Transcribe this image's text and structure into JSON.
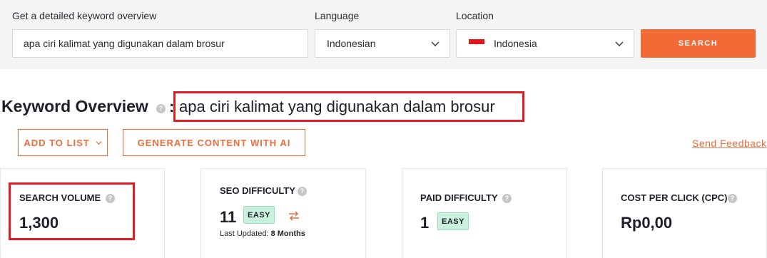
{
  "search_bar": {
    "keyword_label": "Get a detailed keyword overview",
    "keyword_value": "apa ciri kalimat yang digunakan dalam brosur",
    "language_label": "Language",
    "language_value": "Indonesian",
    "location_label": "Location",
    "location_value": "Indonesia",
    "search_button": "SEARCH"
  },
  "overview": {
    "title": "Keyword Overview",
    "separator": ":",
    "keyword": "apa ciri kalimat yang digunakan dalam brosur",
    "help_glyph": "?"
  },
  "actions": {
    "add_to_list": "ADD TO LIST",
    "generate_ai": "GENERATE CONTENT WITH AI",
    "send_feedback": "Send Feedback"
  },
  "metrics": {
    "search_volume": {
      "label": "SEARCH VOLUME",
      "value": "1,300"
    },
    "seo_difficulty": {
      "label": "SEO DIFFICULTY",
      "value": "11",
      "badge": "EASY",
      "updated_prefix": "Last Updated:",
      "updated_value": "8 Months"
    },
    "paid_difficulty": {
      "label": "PAID DIFFICULTY",
      "value": "1",
      "badge": "EASY"
    },
    "cpc": {
      "label": "COST PER CLICK (CPC)",
      "value": "Rp0,00"
    }
  },
  "colors": {
    "accent": "#f26a35",
    "highlight_box": "#e31b23",
    "easy_badge": "#c9f2dc",
    "panel_bg": "#f4f5f4"
  },
  "icons": [
    "chevron-down-icon",
    "indonesia-flag-icon",
    "help-icon",
    "refresh-swap-icon"
  ]
}
